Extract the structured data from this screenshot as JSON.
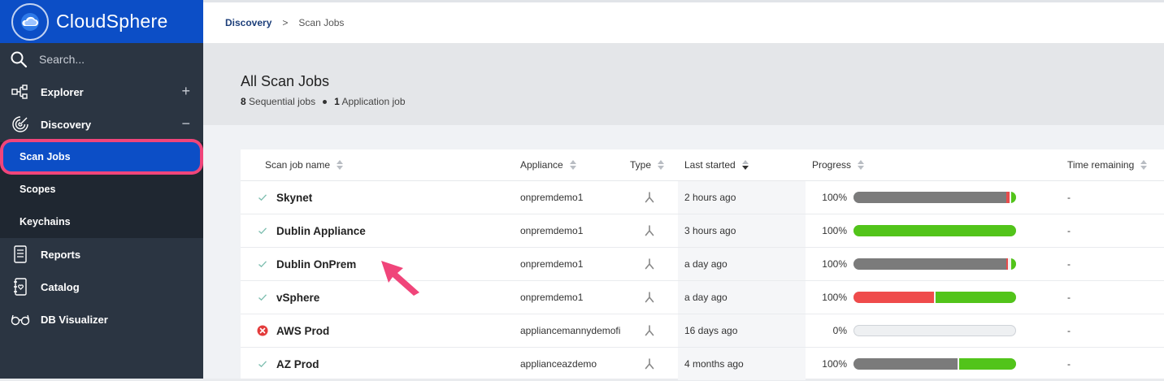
{
  "app": {
    "name": "CloudSphere"
  },
  "sidebar": {
    "search_placeholder": "Search...",
    "items": [
      {
        "label": "Explorer",
        "toggle": "+"
      },
      {
        "label": "Discovery",
        "toggle": "−"
      },
      {
        "label": "Reports"
      },
      {
        "label": "Catalog"
      },
      {
        "label": "DB Visualizer"
      }
    ],
    "discovery_sub": [
      {
        "label": "Scan Jobs",
        "active": true
      },
      {
        "label": "Scopes"
      },
      {
        "label": "Keychains"
      }
    ]
  },
  "breadcrumb": {
    "parent": "Discovery",
    "separator": ">",
    "current": "Scan Jobs"
  },
  "page": {
    "title": "All Scan Jobs",
    "sequential_count": "8",
    "sequential_label": "Sequential jobs",
    "application_count": "1",
    "application_label": "Application job"
  },
  "table": {
    "columns": {
      "name": "Scan job name",
      "appliance": "Appliance",
      "type": "Type",
      "started": "Last started",
      "progress": "Progress",
      "remaining": "Time remaining"
    },
    "rows": [
      {
        "status": "success",
        "name": "Skynet",
        "appliance": "onpremdemo1",
        "type_icon": "sequential-icon",
        "started": "2 hours ago",
        "progress": "100%",
        "segments": [
          {
            "color": "#7b7b7b",
            "fraction": 0.94
          },
          {
            "color": "#e84c4c",
            "fraction": 0.02
          },
          {
            "color": "#f2f2f2",
            "fraction": 0.01
          },
          {
            "color": "#52c41a",
            "fraction": 0.03
          }
        ],
        "remaining": "-"
      },
      {
        "status": "success",
        "name": "Dublin Appliance",
        "appliance": "onpremdemo1",
        "type_icon": "sequential-icon",
        "started": "3 hours ago",
        "progress": "100%",
        "segments": [
          {
            "color": "#52c41a",
            "fraction": 1.0
          }
        ],
        "remaining": "-"
      },
      {
        "status": "success",
        "name": "Dublin OnPrem",
        "appliance": "onpremdemo1",
        "type_icon": "sequential-icon",
        "started": "a day ago",
        "progress": "100%",
        "segments": [
          {
            "color": "#7b7b7b",
            "fraction": 0.94
          },
          {
            "color": "#e84c4c",
            "fraction": 0.01
          },
          {
            "color": "#f2f2f2",
            "fraction": 0.02
          },
          {
            "color": "#52c41a",
            "fraction": 0.03
          }
        ],
        "remaining": "-"
      },
      {
        "status": "success",
        "name": "vSphere",
        "appliance": "onpremdemo1",
        "type_icon": "sequential-icon",
        "started": "a day ago",
        "progress": "100%",
        "segments": [
          {
            "color": "#ef4b4b",
            "fraction": 0.495
          },
          {
            "color": "#f2f2f2",
            "fraction": 0.01
          },
          {
            "color": "#52c41a",
            "fraction": 0.495
          }
        ],
        "remaining": "-"
      },
      {
        "status": "error",
        "name": "AWS Prod",
        "appliance": "appliancemannydemofi",
        "type_icon": "sequential-icon",
        "started": "16 days ago",
        "progress": "0%",
        "segments": [],
        "remaining": "-"
      },
      {
        "status": "success",
        "name": "AZ Prod",
        "appliance": "applianceazdemo",
        "type_icon": "sequential-icon",
        "started": "4 months ago",
        "progress": "100%",
        "segments": [
          {
            "color": "#7b7b7b",
            "fraction": 0.64
          },
          {
            "color": "#f2f2f2",
            "fraction": 0.01
          },
          {
            "color": "#52c41a",
            "fraction": 0.35
          }
        ],
        "remaining": "-"
      }
    ]
  },
  "colors": {
    "brand": "#0c4ec6",
    "sidebar_bg": "#2b3542",
    "highlight": "#f0457a",
    "success": "#52c41a",
    "error": "#e33b3b",
    "completed_gray": "#7b7b7b"
  }
}
